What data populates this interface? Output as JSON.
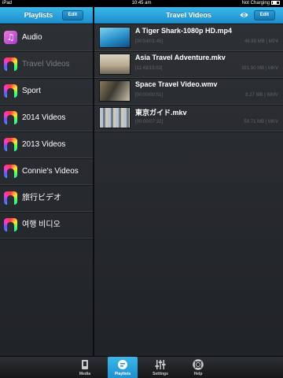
{
  "status": {
    "device": "iPad",
    "time": "10:45 am",
    "battery": "Not Charging"
  },
  "left_nav": {
    "title": "Playlists",
    "edit_label": "Edit"
  },
  "right_nav": {
    "title": "Travel Videos",
    "edit_label": "Edit",
    "icon": "eye-icon"
  },
  "playlists": [
    {
      "label": "Audio",
      "icon": "music-icon",
      "selected": false
    },
    {
      "label": "Travel Videos",
      "icon": "video-icon",
      "selected": true
    },
    {
      "label": "Sport",
      "icon": "video-icon",
      "selected": false
    },
    {
      "label": "2014 Videos",
      "icon": "video-icon",
      "selected": false
    },
    {
      "label": "2013 Videos",
      "icon": "video-icon",
      "selected": false
    },
    {
      "label": "Connie's Videos",
      "icon": "video-icon",
      "selected": false
    },
    {
      "label": "旅行ビデオ",
      "icon": "video-icon",
      "selected": false
    },
    {
      "label": "여행 비디오",
      "icon": "video-icon",
      "selected": false
    }
  ],
  "videos": [
    {
      "title": "A Tiger Shark-1080p HD.mp4",
      "duration": "[00:54/01:45]",
      "size": "46.88 MB | MP4"
    },
    {
      "title": "Asia Travel Adventure.mkv",
      "duration": "[11:43/15:02]",
      "size": "391.90 MB | MKV"
    },
    {
      "title": "Space Travel Video.wmv",
      "duration": "[00:00/00:51]",
      "size": "8.27 MB | WMV"
    },
    {
      "title": "東京ガイド.mkv",
      "duration": "[00:00/07:32]",
      "size": "59.71 MB | MKV"
    }
  ],
  "tabs": [
    {
      "label": "Media",
      "icon": "media-icon",
      "active": false
    },
    {
      "label": "Playlists",
      "icon": "playlist-icon",
      "active": true
    },
    {
      "label": "Settings",
      "icon": "settings-sliders-icon",
      "active": false
    },
    {
      "label": "Help",
      "icon": "help-lifebuoy-icon",
      "active": false
    }
  ],
  "colors": {
    "accent": "#2aa5e0",
    "background": "#25282c"
  }
}
